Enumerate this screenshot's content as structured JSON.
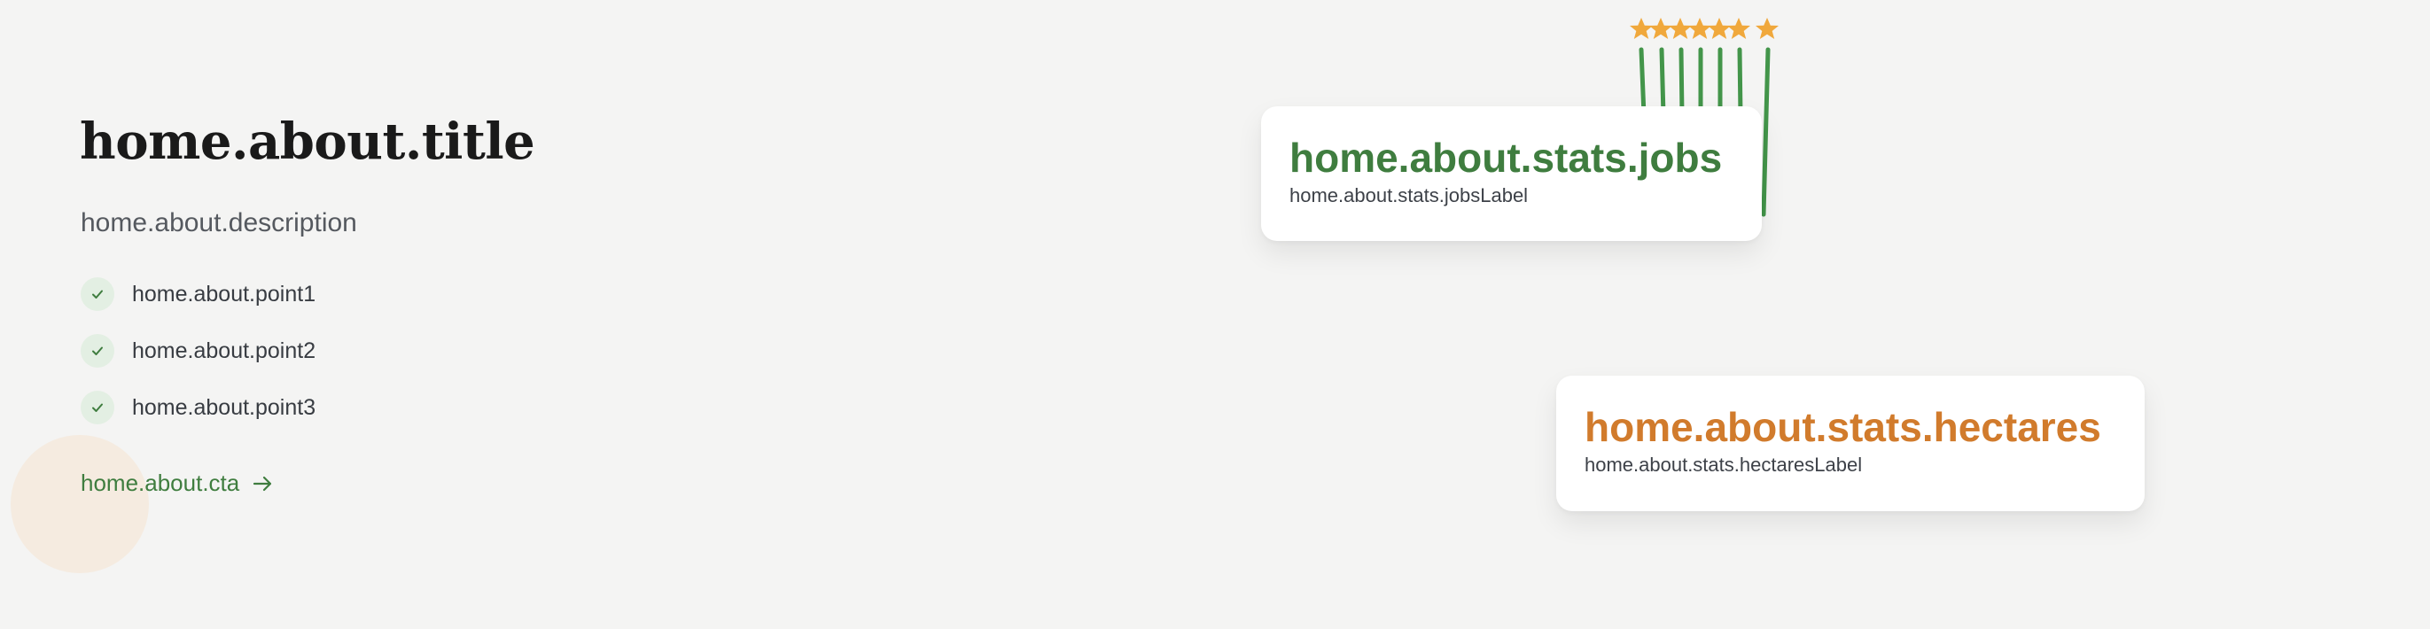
{
  "about": {
    "title": "home.about.title",
    "description": "home.about.description",
    "points": [
      "home.about.point1",
      "home.about.point2",
      "home.about.point3"
    ],
    "cta": "home.about.cta"
  },
  "stats": {
    "jobs": "home.about.stats.jobs",
    "jobs_label": "home.about.stats.jobsLabel",
    "hectares": "home.about.stats.hectares",
    "hectares_label": "home.about.stats.hectaresLabel"
  },
  "icons": {
    "check": "check-icon",
    "arrow": "arrow-right-icon",
    "star": "star-icon"
  },
  "colors": {
    "accent_green": "#3f7d3f",
    "accent_orange": "#d17b2c",
    "star": "#f0a83c"
  }
}
